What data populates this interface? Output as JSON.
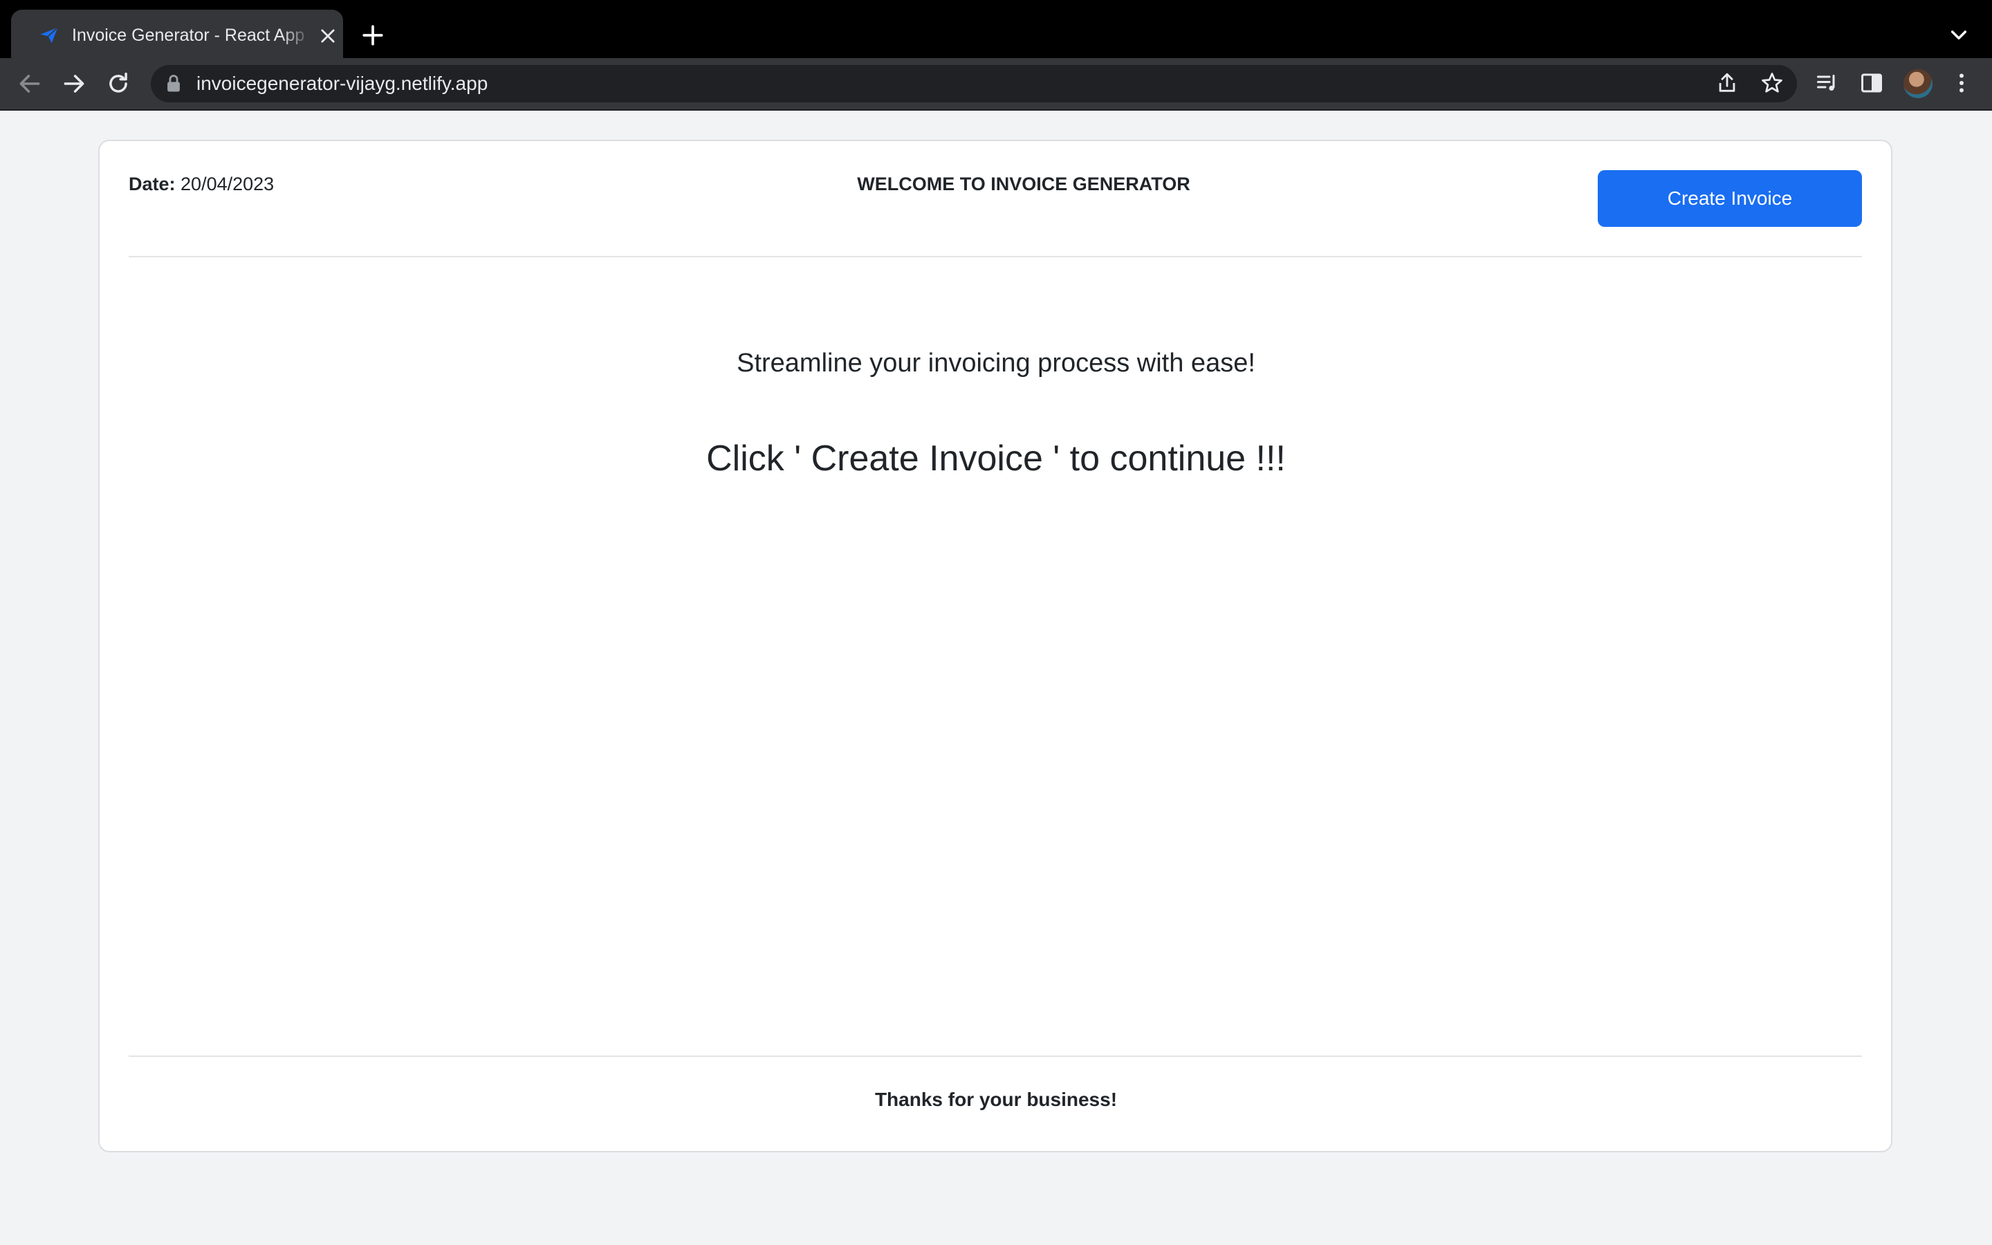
{
  "browser": {
    "tab": {
      "title": "Invoice Generator - React App",
      "favicon": "paper-plane-icon"
    },
    "address_bar": {
      "url": "invoicegenerator-vijayg.netlify.app"
    },
    "icons": {
      "back": "arrow-left-icon",
      "forward": "arrow-right-icon",
      "reload": "reload-icon",
      "lock": "lock-icon",
      "share": "share-icon",
      "bookmark": "star-icon",
      "media": "media-control-icon",
      "side_panel": "side-panel-icon",
      "menu": "kebab-menu-icon"
    }
  },
  "page": {
    "date_label": "Date:",
    "date_value": "20/04/2023",
    "heading": "WELCOME TO INVOICE GENERATOR",
    "create_button_label": "Create Invoice",
    "tagline": "Streamline your invoicing process with ease!",
    "cta": "Click ' Create Invoice ' to continue !!!",
    "footer": "Thanks for your business!"
  },
  "colors": {
    "accent": "#1a6ef2",
    "page_background": "#f2f3f5",
    "text": "#212529",
    "chrome_dark": "#35363a"
  }
}
